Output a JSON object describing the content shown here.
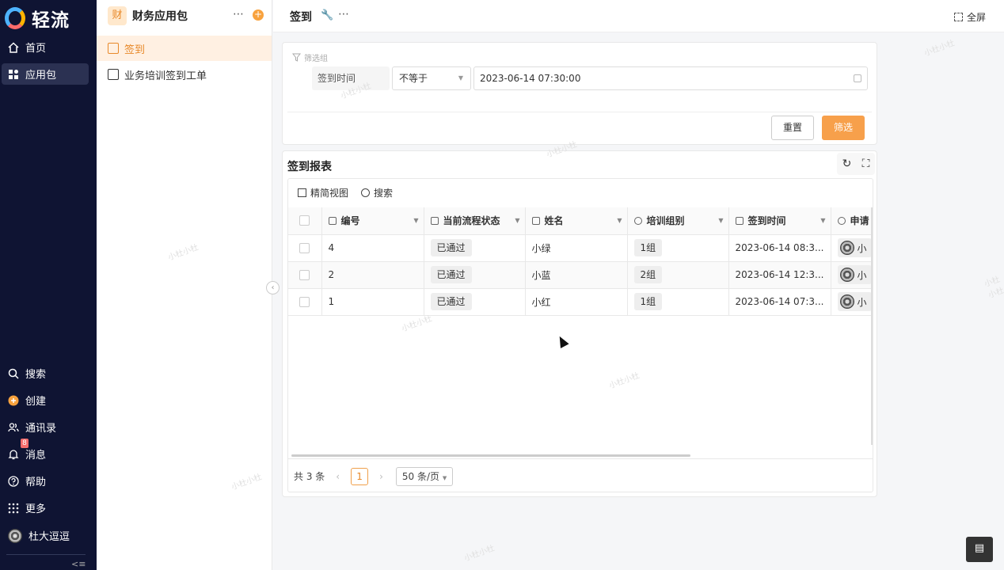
{
  "nav": {
    "brand": "轻流",
    "items": [
      {
        "label": "首页",
        "icon": "home-icon"
      },
      {
        "label": "应用包",
        "icon": "apps-icon"
      }
    ],
    "bottom_items": [
      {
        "label": "搜索",
        "icon": "search-icon"
      },
      {
        "label": "创建",
        "icon": "plus-icon"
      },
      {
        "label": "通讯录",
        "icon": "contacts-icon"
      },
      {
        "label": "消息",
        "icon": "bell-icon",
        "badge": "8"
      },
      {
        "label": "帮助",
        "icon": "help-icon"
      },
      {
        "label": "更多",
        "icon": "grid-icon"
      },
      {
        "label": "杜大逗逗",
        "icon": "avatar"
      }
    ]
  },
  "package": {
    "icon_char": "财",
    "title": "财务应用包",
    "items": [
      {
        "label": "签到",
        "active": true
      },
      {
        "label": "业务培训签到工单",
        "active": false
      }
    ]
  },
  "topbar": {
    "title": "签到",
    "fullscreen_label": "全屏"
  },
  "filter": {
    "group_label": "筛选组",
    "field_label": "签到时间",
    "operator": "不等于",
    "value": "2023-06-14 07:30:00",
    "reset_label": "重置",
    "submit_label": "筛选"
  },
  "report": {
    "title": "签到报表",
    "toolbar": {
      "view_label": "精简视图",
      "search_label": "搜索"
    },
    "columns": [
      "编号",
      "当前流程状态",
      "姓名",
      "培训组别",
      "签到时间",
      "申请"
    ],
    "rows": [
      {
        "id": "4",
        "status": "已通过",
        "name": "小绿",
        "group": "1组",
        "time": "2023-06-14 08:3...",
        "user": "小"
      },
      {
        "id": "2",
        "status": "已通过",
        "name": "小蓝",
        "group": "2组",
        "time": "2023-06-14 12:3...",
        "user": "小"
      },
      {
        "id": "1",
        "status": "已通过",
        "name": "小红",
        "group": "1组",
        "time": "2023-06-14 07:3...",
        "user": "小"
      }
    ],
    "footer": {
      "total": "共 3 条",
      "current_page": "1",
      "page_size": "50 条/页"
    }
  },
  "watermark": "小杜小杜",
  "colors": {
    "accent": "#f7a04b",
    "nav_bg": "#0f1433"
  }
}
